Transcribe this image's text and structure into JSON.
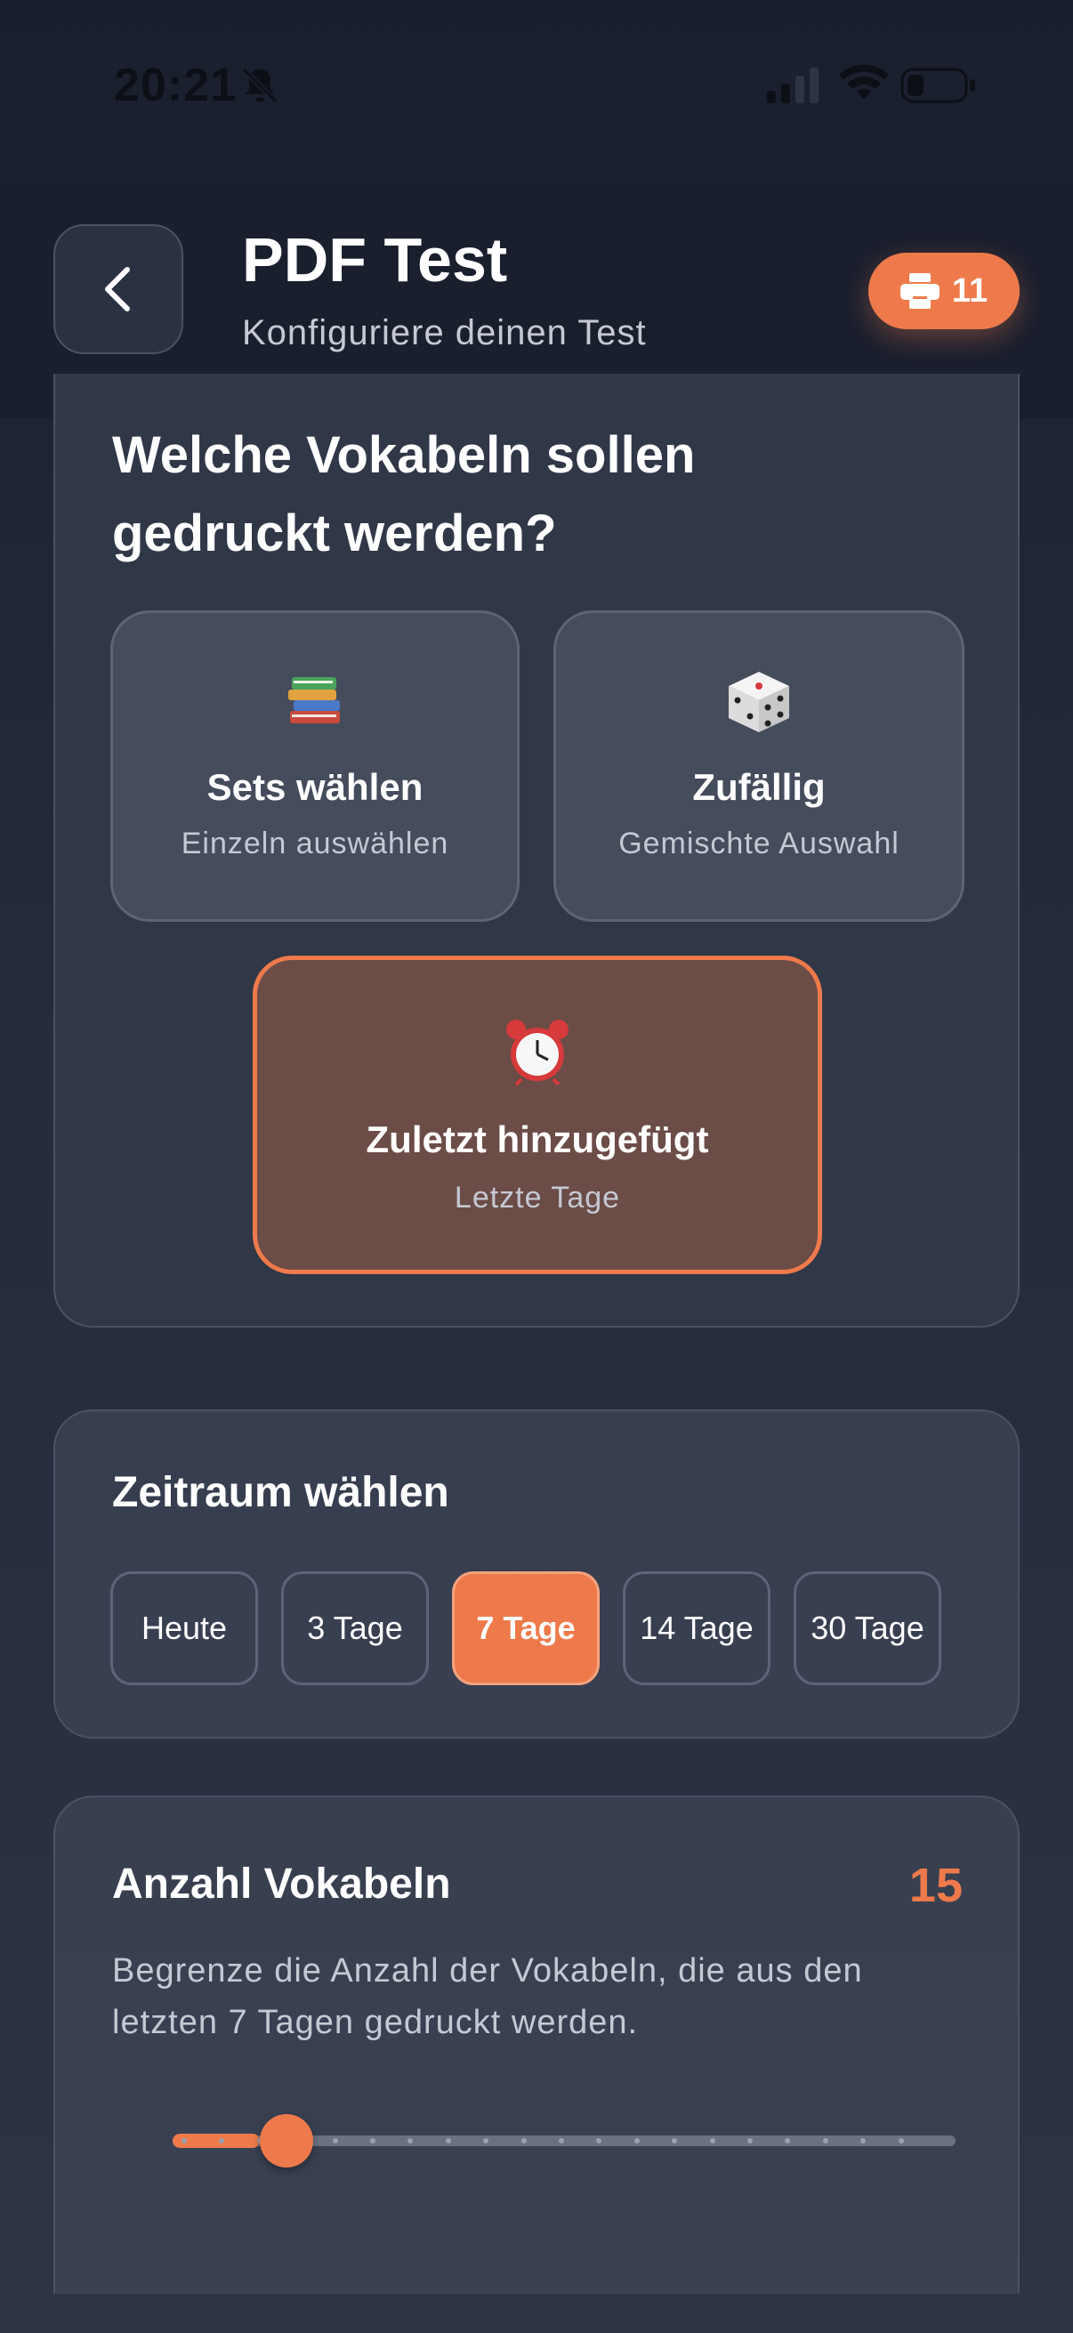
{
  "status_bar": {
    "time": "20:21"
  },
  "header": {
    "title": "PDF Test",
    "subtitle": "Konfiguriere deinen Test",
    "print_count": "11"
  },
  "selection": {
    "question": "Welche Vokabeln sollen gedruckt werden?",
    "options": [
      {
        "icon": "books-emoji",
        "label": "Sets wählen",
        "sub": "Einzeln auswählen",
        "selected": false
      },
      {
        "icon": "dice-emoji",
        "label": "Zufällig",
        "sub": "Gemischte Auswahl",
        "selected": false
      },
      {
        "icon": "alarm-clock-emoji",
        "label": "Zuletzt hinzugefügt",
        "sub": "Letzte Tage",
        "selected": true
      }
    ]
  },
  "timeframe": {
    "title": "Zeitraum wählen",
    "options": [
      "Heute",
      "3 Tage",
      "7 Tage",
      "14 Tage",
      "30 Tage"
    ],
    "selected": "7 Tage"
  },
  "count": {
    "title": "Anzahl Vokabeln",
    "value": "15",
    "description": "Begrenze die Anzahl der Vokabeln, die aus den letzten 7 Tagen gedruckt werden.",
    "slider_fraction": 0.1
  },
  "colors": {
    "accent": "#ee7a4b",
    "background": "#1a1f2e",
    "card": "#303747"
  }
}
